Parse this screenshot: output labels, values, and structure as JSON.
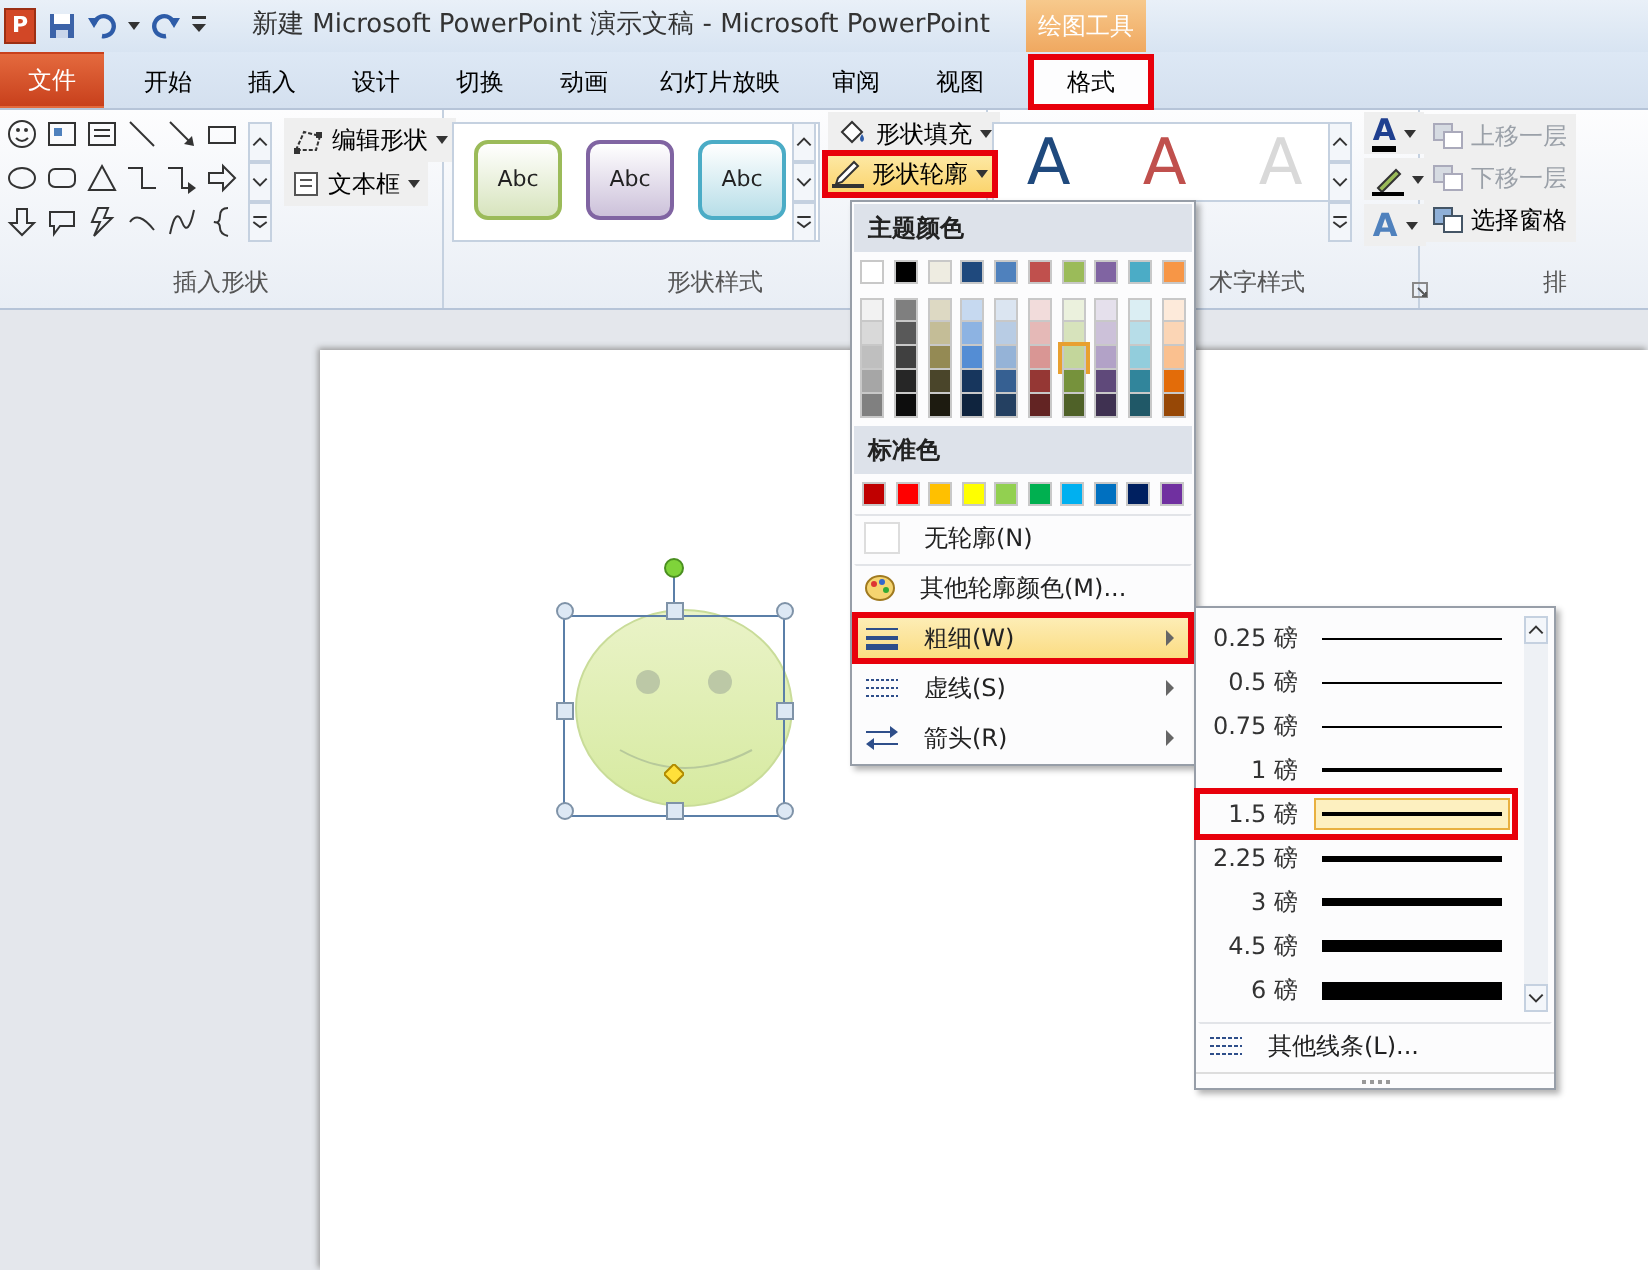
{
  "title_bar": {
    "app_letter": "P",
    "title": "新建 Microsoft PowerPoint 演示文稿 - Microsoft PowerPoint",
    "context_label": "绘图工具"
  },
  "tabs": [
    {
      "label": "文件",
      "kind": "file",
      "selected": false,
      "annotated": false
    },
    {
      "label": "开始",
      "kind": "tab",
      "selected": false,
      "annotated": false
    },
    {
      "label": "插入",
      "kind": "tab",
      "selected": false,
      "annotated": false
    },
    {
      "label": "设计",
      "kind": "tab",
      "selected": false,
      "annotated": false
    },
    {
      "label": "切换",
      "kind": "tab",
      "selected": false,
      "annotated": false
    },
    {
      "label": "动画",
      "kind": "tab",
      "selected": false,
      "annotated": false
    },
    {
      "label": "幻灯片放映",
      "kind": "tab",
      "selected": false,
      "annotated": false
    },
    {
      "label": "审阅",
      "kind": "tab",
      "selected": false,
      "annotated": false
    },
    {
      "label": "视图",
      "kind": "tab",
      "selected": false,
      "annotated": false
    },
    {
      "label": "格式",
      "kind": "context",
      "selected": true,
      "annotated": true
    }
  ],
  "ribbon": {
    "groups": [
      {
        "kind": "shapes",
        "label": "插入形状",
        "buttons": [
          {
            "label": "编辑形状",
            "highlighted": false,
            "annotated": false
          },
          {
            "label": "文本框",
            "highlighted": false,
            "annotated": false
          }
        ]
      },
      {
        "kind": "styles",
        "label": "形状样式",
        "styles": [
          {
            "text": "Abc",
            "color": "#d7e4bd"
          },
          {
            "text": "Abc",
            "color": "#ccc1da"
          },
          {
            "text": "Abc",
            "color": "#b7dee8"
          }
        ],
        "buttons": [
          {
            "label": "形状填充",
            "highlighted": false,
            "annotated": false
          },
          {
            "label": "形状轮廓",
            "highlighted": true,
            "annotated": true
          }
        ]
      },
      {
        "kind": "wordart",
        "label": "术字样式",
        "samples": [
          {
            "text": "A",
            "color": "#1f497d"
          },
          {
            "text": "A",
            "color": "#c0504d"
          },
          {
            "text": "A",
            "color": "#d9d9d9"
          }
        ],
        "side_letters": [
          "A",
          "A"
        ]
      },
      {
        "kind": "arrange",
        "label": "排",
        "buttons": [
          {
            "label": "上移一层",
            "disabled": true
          },
          {
            "label": "下移一层",
            "disabled": true
          },
          {
            "label": "选择窗格",
            "disabled": false
          }
        ]
      }
    ]
  },
  "outline_menu": {
    "theme_heading": "主题颜色",
    "theme_rows": [
      {
        "swatches": [
          {
            "color": "#ffffff",
            "selected": false
          },
          {
            "color": "#000000",
            "selected": false
          },
          {
            "color": "#eeece1",
            "selected": false
          },
          {
            "color": "#1f497d",
            "selected": false
          },
          {
            "color": "#4f81bd",
            "selected": false
          },
          {
            "color": "#c0504d",
            "selected": false
          },
          {
            "color": "#9bbb59",
            "selected": false
          },
          {
            "color": "#8064a2",
            "selected": false
          },
          {
            "color": "#4bacc6",
            "selected": false
          },
          {
            "color": "#f79646",
            "selected": false
          }
        ]
      },
      {
        "swatches": [
          {
            "color": "#f2f2f2",
            "selected": false
          },
          {
            "color": "#7f7f7f",
            "selected": false
          },
          {
            "color": "#ddd9c3",
            "selected": false
          },
          {
            "color": "#c6d9f0",
            "selected": false
          },
          {
            "color": "#dbe5f1",
            "selected": false
          },
          {
            "color": "#f2dcdb",
            "selected": false
          },
          {
            "color": "#ebf1dd",
            "selected": false
          },
          {
            "color": "#e5e0ec",
            "selected": false
          },
          {
            "color": "#dbeef3",
            "selected": false
          },
          {
            "color": "#fdeada",
            "selected": false
          }
        ]
      },
      {
        "swatches": [
          {
            "color": "#d9d9d9",
            "selected": false
          },
          {
            "color": "#595959",
            "selected": false
          },
          {
            "color": "#c4bd97",
            "selected": false
          },
          {
            "color": "#8db3e2",
            "selected": false
          },
          {
            "color": "#b8cce4",
            "selected": false
          },
          {
            "color": "#e5b9b7",
            "selected": false
          },
          {
            "color": "#d7e3bc",
            "selected": false
          },
          {
            "color": "#ccc1d9",
            "selected": false
          },
          {
            "color": "#b7dde8",
            "selected": false
          },
          {
            "color": "#fbd5b5",
            "selected": false
          }
        ]
      },
      {
        "swatches": [
          {
            "color": "#bfbfbf",
            "selected": false
          },
          {
            "color": "#404040",
            "selected": false
          },
          {
            "color": "#948a54",
            "selected": false
          },
          {
            "color": "#548dd4",
            "selected": false
          },
          {
            "color": "#95b3d7",
            "selected": false
          },
          {
            "color": "#d99694",
            "selected": false
          },
          {
            "color": "#c3d69b",
            "selected": true
          },
          {
            "color": "#b2a2c7",
            "selected": false
          },
          {
            "color": "#92cddc",
            "selected": false
          },
          {
            "color": "#fac08f",
            "selected": false
          }
        ]
      },
      {
        "swatches": [
          {
            "color": "#a6a6a6",
            "selected": false
          },
          {
            "color": "#262626",
            "selected": false
          },
          {
            "color": "#4a452a",
            "selected": false
          },
          {
            "color": "#17365d",
            "selected": false
          },
          {
            "color": "#366092",
            "selected": false
          },
          {
            "color": "#953734",
            "selected": false
          },
          {
            "color": "#76923c",
            "selected": false
          },
          {
            "color": "#5f497a",
            "selected": false
          },
          {
            "color": "#31859b",
            "selected": false
          },
          {
            "color": "#e36c09",
            "selected": false
          }
        ]
      },
      {
        "swatches": [
          {
            "color": "#808080",
            "selected": false
          },
          {
            "color": "#0d0d0d",
            "selected": false
          },
          {
            "color": "#1d1b10",
            "selected": false
          },
          {
            "color": "#0f243e",
            "selected": false
          },
          {
            "color": "#244061",
            "selected": false
          },
          {
            "color": "#632423",
            "selected": false
          },
          {
            "color": "#4f6128",
            "selected": false
          },
          {
            "color": "#3f3151",
            "selected": false
          },
          {
            "color": "#205867",
            "selected": false
          },
          {
            "color": "#974806",
            "selected": false
          }
        ]
      }
    ],
    "standard_heading": "标准色",
    "standard_colors": [
      {
        "color": "#c00000",
        "selected": false
      },
      {
        "color": "#ff0000",
        "selected": false
      },
      {
        "color": "#ffc000",
        "selected": false
      },
      {
        "color": "#ffff00",
        "selected": false
      },
      {
        "color": "#92d050",
        "selected": false
      },
      {
        "color": "#00b050",
        "selected": false
      },
      {
        "color": "#00b0f0",
        "selected": false
      },
      {
        "color": "#0070c0",
        "selected": false
      },
      {
        "color": "#002060",
        "selected": false
      },
      {
        "color": "#7030a0",
        "selected": false
      }
    ],
    "items": [
      {
        "kind": "no_outline",
        "label": "无轮廓(N)",
        "highlighted": false,
        "annotated": false,
        "submenu": false
      },
      {
        "kind": "more_colors",
        "label": "其他轮廓颜色(M)...",
        "highlighted": false,
        "annotated": false,
        "submenu": false
      },
      {
        "kind": "weight",
        "label": "粗细(W)",
        "highlighted": true,
        "annotated": true,
        "submenu": true
      },
      {
        "kind": "dashes",
        "label": "虚线(S)",
        "highlighted": false,
        "annotated": false,
        "submenu": true
      },
      {
        "kind": "arrows",
        "label": "箭头(R)",
        "highlighted": false,
        "annotated": false,
        "submenu": true
      }
    ]
  },
  "weight_submenu": {
    "items": [
      {
        "label": "0.25 磅",
        "selected": false,
        "annotated": false
      },
      {
        "label": "0.5 磅",
        "selected": false,
        "annotated": false
      },
      {
        "label": "0.75 磅",
        "selected": false,
        "annotated": false
      },
      {
        "label": "1 磅",
        "selected": false,
        "annotated": false
      },
      {
        "label": "1.5 磅",
        "selected": true,
        "annotated": true
      },
      {
        "label": "2.25 磅",
        "selected": false,
        "annotated": false
      },
      {
        "label": "3 磅",
        "selected": false,
        "annotated": false
      },
      {
        "label": "4.5 磅",
        "selected": false,
        "annotated": false
      },
      {
        "label": "6 磅",
        "selected": false,
        "annotated": false
      }
    ],
    "more": "其他线条(L)..."
  }
}
